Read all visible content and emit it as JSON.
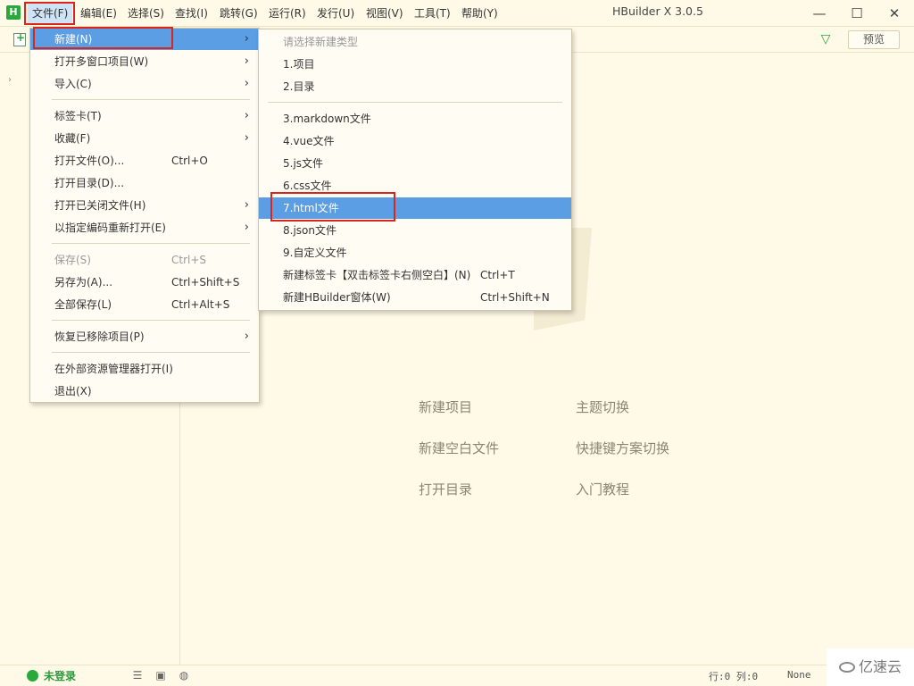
{
  "app": {
    "window_title": "HBuilder X 3.0.5",
    "logo_letter": "H"
  },
  "menubar": {
    "items": [
      "文件(F)",
      "编辑(E)",
      "选择(S)",
      "查找(I)",
      "跳转(G)",
      "运行(R)",
      "发行(U)",
      "视图(V)",
      "工具(T)",
      "帮助(Y)"
    ]
  },
  "window_controls": {
    "minimize": "—",
    "maximize": "☐",
    "close": "✕"
  },
  "toolbar": {
    "preview_label": "预览",
    "filter_icon": "▽"
  },
  "file_menu": {
    "items": [
      {
        "label": "新建(N)",
        "shortcut": "",
        "submenu": "›"
      },
      {
        "label": "打开多窗口项目(W)",
        "shortcut": "",
        "submenu": "›"
      },
      {
        "label": "导入(C)",
        "shortcut": "",
        "submenu": "›"
      },
      {
        "label": "标签卡(T)",
        "shortcut": "",
        "submenu": "›"
      },
      {
        "label": "收藏(F)",
        "shortcut": "",
        "submenu": "›"
      },
      {
        "label": "打开文件(O)...",
        "shortcut": "Ctrl+O",
        "submenu": ""
      },
      {
        "label": "打开目录(D)...",
        "shortcut": "",
        "submenu": ""
      },
      {
        "label": "打开已关闭文件(H)",
        "shortcut": "",
        "submenu": "›"
      },
      {
        "label": "以指定编码重新打开(E)",
        "shortcut": "",
        "submenu": "›"
      },
      {
        "label": "保存(S)",
        "shortcut": "Ctrl+S",
        "submenu": ""
      },
      {
        "label": "另存为(A)...",
        "shortcut": "Ctrl+Shift+S",
        "submenu": ""
      },
      {
        "label": "全部保存(L)",
        "shortcut": "Ctrl+Alt+S",
        "submenu": ""
      },
      {
        "label": "恢复已移除项目(P)",
        "shortcut": "",
        "submenu": "›"
      },
      {
        "label": "在外部资源管理器打开(I)",
        "shortcut": "",
        "submenu": ""
      },
      {
        "label": "退出(X)",
        "shortcut": "",
        "submenu": ""
      }
    ]
  },
  "new_submenu": {
    "header": "请选择新建类型",
    "items": [
      {
        "label": "1.项目",
        "shortcut": ""
      },
      {
        "label": "2.目录",
        "shortcut": ""
      },
      {
        "label": "3.markdown文件",
        "shortcut": ""
      },
      {
        "label": "4.vue文件",
        "shortcut": ""
      },
      {
        "label": "5.js文件",
        "shortcut": ""
      },
      {
        "label": "6.css文件",
        "shortcut": ""
      },
      {
        "label": "7.html文件",
        "shortcut": ""
      },
      {
        "label": "8.json文件",
        "shortcut": ""
      },
      {
        "label": "9.自定义文件",
        "shortcut": ""
      },
      {
        "label": "新建标签卡【双击标签卡右侧空白】(N)",
        "shortcut": "Ctrl+T"
      },
      {
        "label": "新建HBuilder窗体(W)",
        "shortcut": "Ctrl+Shift+N"
      }
    ]
  },
  "welcome": {
    "links": [
      "新建项目",
      "主题切换",
      "新建空白文件",
      "快捷键方案切换",
      "打开目录",
      "入门教程"
    ]
  },
  "statusbar": {
    "login": "未登录",
    "line_col": "行:0  列:0",
    "encoding": "None"
  },
  "watermark": {
    "text": "亿速云"
  }
}
